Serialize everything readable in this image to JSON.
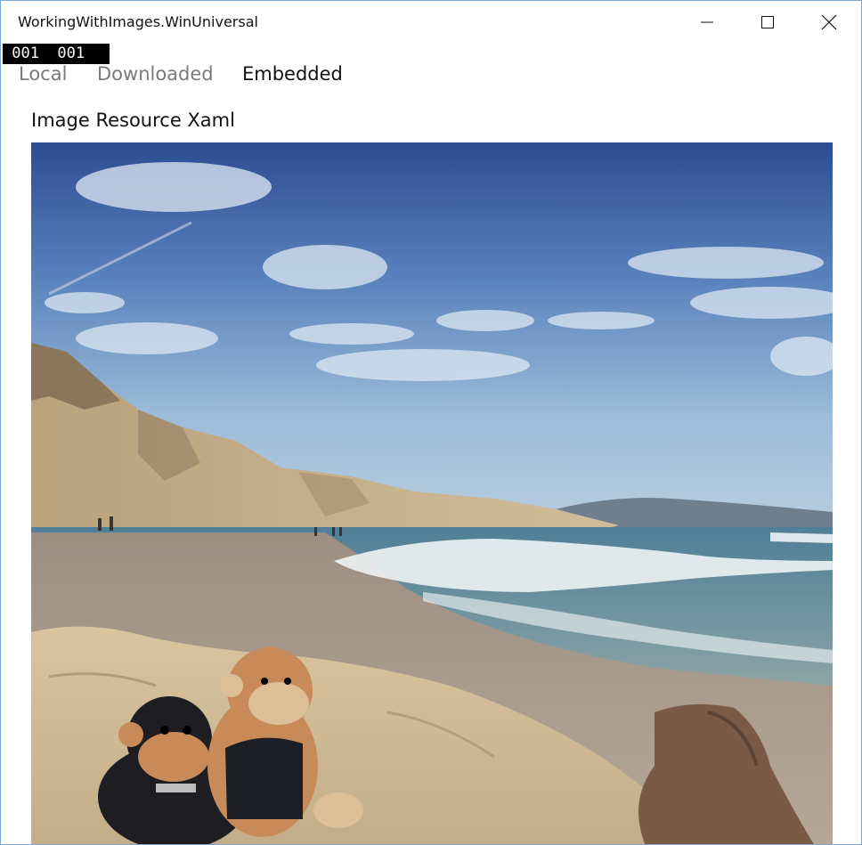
{
  "window": {
    "title": "WorkingWithImages.WinUniversal"
  },
  "caption_buttons": {
    "minimize_icon": "minimize-icon",
    "maximize_icon": "maximize-icon",
    "close_icon": "close-icon"
  },
  "frame_counter": {
    "text": " 001  001"
  },
  "tabs": [
    {
      "label": "Local",
      "selected": false
    },
    {
      "label": "Downloaded",
      "selected": false
    },
    {
      "label": "Embedded",
      "selected": true
    }
  ],
  "page": {
    "heading": "Image Resource Xaml"
  },
  "colors": {
    "selected_tab": "#111111",
    "unselected_tab": "#7a7a7a",
    "window_border": "#7aa7d6"
  }
}
